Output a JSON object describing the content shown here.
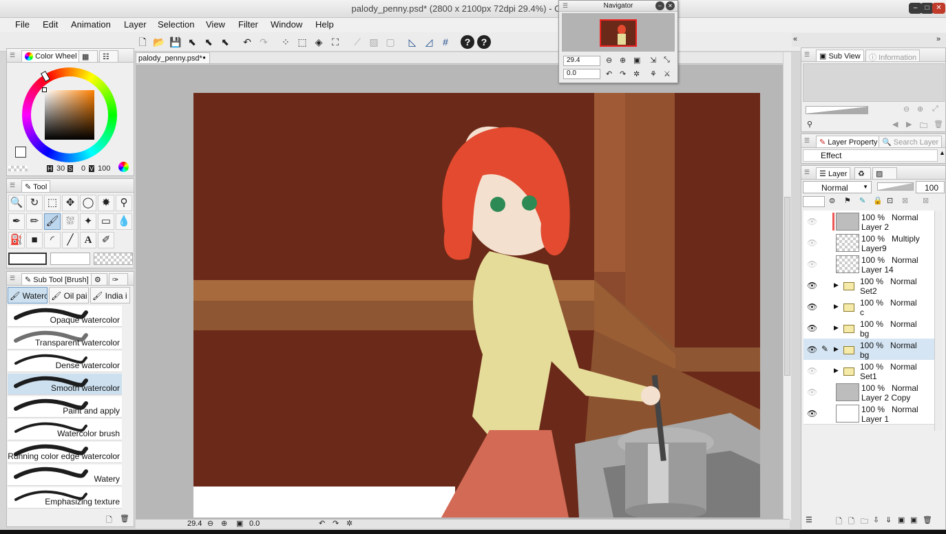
{
  "window": {
    "title": "palody_penny.psd* (2800 x 2100px 72dpi 29.4%)  - CLIP STU",
    "buttons": {
      "minimize": "–",
      "maximize": "□",
      "close": "✕"
    }
  },
  "menu": [
    "File",
    "Edit",
    "Animation",
    "Layer",
    "Selection",
    "View",
    "Filter",
    "Window",
    "Help"
  ],
  "color_panel": {
    "tabs": [
      "Color Wheel"
    ],
    "h_label": "H",
    "h_value": "30",
    "s_label": "S",
    "s_value": "0",
    "v_label": "V",
    "v_value": "100"
  },
  "tool_panel": {
    "title": "Tool"
  },
  "sub_tool_panel": {
    "title": "Sub Tool [Brush]",
    "tabs": [
      "Waterc",
      "Oil pai",
      "India i"
    ],
    "brushes": [
      "Opaque watercolor",
      "Transparent watercolor",
      "Dense watercolor",
      "Smooth watercolor",
      "Paint and apply",
      "Watercolor brush",
      "Running color edge watercolor",
      "Watery",
      "Emphasizing texture"
    ],
    "active_index": 3
  },
  "canvas": {
    "tab_label": "palody_penny.psd*",
    "zoom": "29.4",
    "rotation": "0.0"
  },
  "navigator": {
    "title": "Navigator",
    "zoom": "29.4",
    "rotation": "0.0"
  },
  "right_panels": {
    "subview_tabs": [
      "Sub View",
      "Information"
    ],
    "layer_property_tabs": [
      "Layer Property",
      "Search Layer"
    ],
    "effect_label": "Effect",
    "layer_tab": "Layer",
    "blend_mode": "Normal",
    "opacity": "100"
  },
  "layers": [
    {
      "opacity": "100 %",
      "mode": "Normal",
      "name": "Layer 2",
      "visible": false,
      "type": "gray",
      "folder": false,
      "active": false
    },
    {
      "opacity": "100 %",
      "mode": "Multiply",
      "name": "Layer9",
      "visible": false,
      "type": "sketch",
      "folder": false,
      "active": false
    },
    {
      "opacity": "100 %",
      "mode": "Normal",
      "name": "Layer 14",
      "visible": false,
      "type": "checker",
      "folder": false,
      "active": false
    },
    {
      "opacity": "100 %",
      "mode": "Normal",
      "name": "Set2",
      "visible": true,
      "type": "folder",
      "folder": true,
      "active": false
    },
    {
      "opacity": "100 %",
      "mode": "Normal",
      "name": "c",
      "visible": true,
      "type": "folder",
      "folder": true,
      "active": false
    },
    {
      "opacity": "100 %",
      "mode": "Normal",
      "name": "bg",
      "visible": true,
      "type": "folder",
      "folder": true,
      "active": false
    },
    {
      "opacity": "100 %",
      "mode": "Normal",
      "name": "bg",
      "visible": true,
      "type": "folder",
      "folder": true,
      "active": true
    },
    {
      "opacity": "100 %",
      "mode": "Normal",
      "name": "Set1",
      "visible": false,
      "type": "folder",
      "folder": true,
      "active": false
    },
    {
      "opacity": "100 %",
      "mode": "Normal",
      "name": "Layer 2 Copy",
      "visible": false,
      "type": "gray",
      "folder": false,
      "active": false
    },
    {
      "opacity": "100 %",
      "mode": "Normal",
      "name": "Layer 1",
      "visible": true,
      "type": "white",
      "folder": false,
      "active": false
    }
  ],
  "icons": {
    "eye": "👁",
    "expand": "▶",
    "pen": "✎"
  }
}
